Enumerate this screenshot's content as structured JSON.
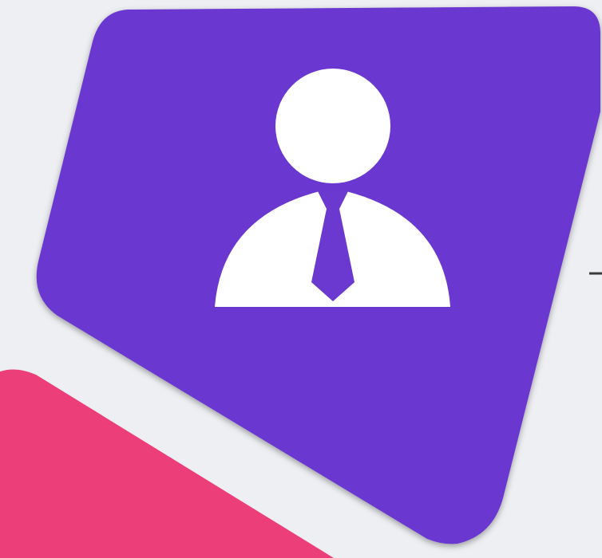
{
  "scene": {
    "background_color": "#eeeff2",
    "primary_card": {
      "color": "#6b38d0",
      "icon": "user-businessman-icon"
    },
    "secondary_card": {
      "color": "#ec3e78"
    },
    "icon_color": "#ffffff",
    "connector_color": "#3a3a3a"
  }
}
